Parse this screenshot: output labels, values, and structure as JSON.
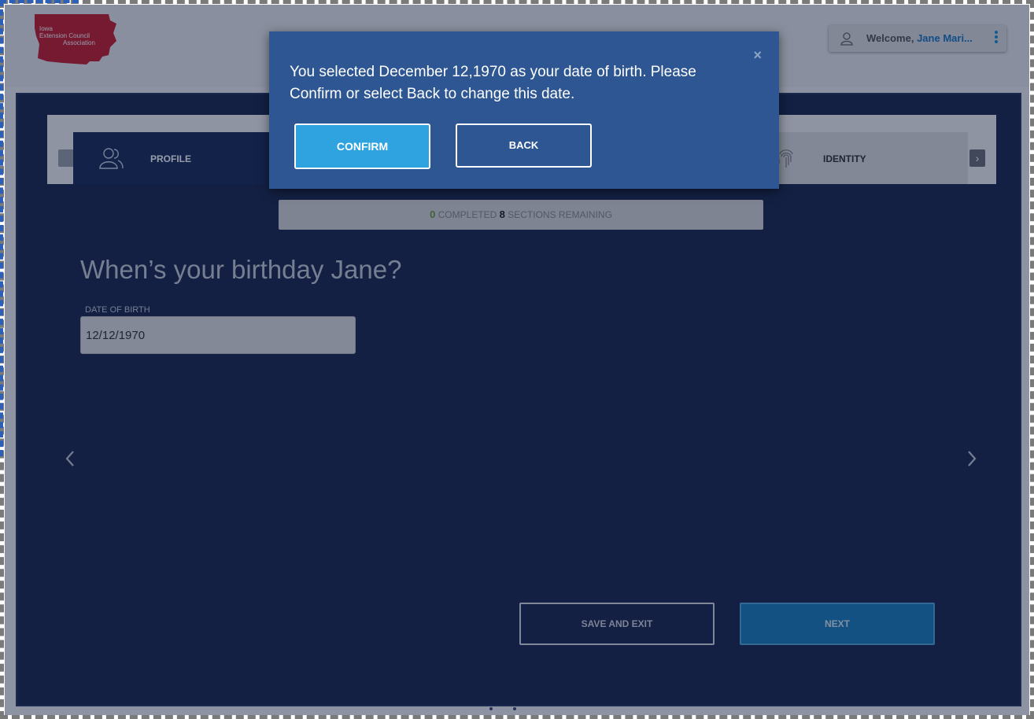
{
  "logo": {
    "line1": "Iowa",
    "line2": "Extension Council",
    "line3": "Association",
    "color": "#c6202f"
  },
  "header": {
    "welcome_prefix": "Welcome,",
    "user_name": "Jane Mari...",
    "user_icon": "user-icon",
    "menu_icon": "kebab-menu-icon"
  },
  "steps": {
    "active_label": "PROFILE",
    "active_icon": "users-icon",
    "last_label": "IDENTITY",
    "last_icon": "fingerprint-icon"
  },
  "progress": {
    "completed_count": "0",
    "completed_label": "COMPLETED",
    "remaining_count": "8",
    "remaining_label": "SECTIONS REMAINING"
  },
  "form": {
    "question": "When’s your birthday Jane?",
    "dob_label": "DATE OF BIRTH",
    "dob_value": "12/12/1970"
  },
  "actions": {
    "save_exit_label": "SAVE AND EXIT",
    "next_label": "NEXT"
  },
  "modal": {
    "message": "You selected December 12,1970 as your date of birth. Please Confirm or select Back to change this date.",
    "confirm_label": "CONFIRM",
    "back_label": "BACK",
    "close_glyph": "×"
  },
  "colors": {
    "page_bg": "#1c2a4f",
    "modal_bg": "#2e5692",
    "confirm_bg": "#2fa3e0",
    "next_bg": "#1a7fb8",
    "accent_blue": "#1a78c2",
    "completed_green": "#6d9c3a"
  }
}
